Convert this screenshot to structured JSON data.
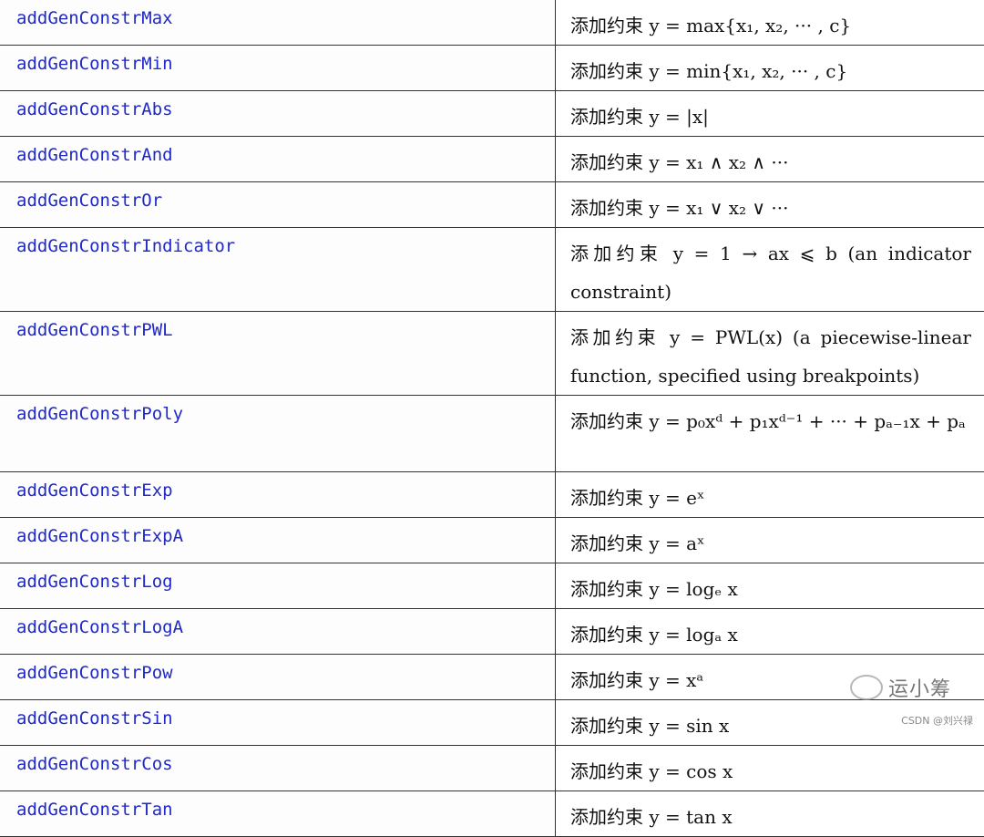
{
  "rows": [
    {
      "fn": "addGenConstrMax",
      "desc": "添加约束 y = max{x₁, x₂, ··· , c}"
    },
    {
      "fn": "addGenConstrMin",
      "desc": "添加约束 y = min{x₁, x₂, ··· , c}"
    },
    {
      "fn": "addGenConstrAbs",
      "desc": "添加约束 y = |x|"
    },
    {
      "fn": "addGenConstrAnd",
      "desc": "添加约束 y = x₁ ∧ x₂ ∧ ···"
    },
    {
      "fn": "addGenConstrOr",
      "desc": "添加约束 y = x₁ ∨ x₂ ∨ ···"
    },
    {
      "fn": "addGenConstrIndicator",
      "desc": "添加约束 y = 1 → ax ⩽ b (an indicator constraint)"
    },
    {
      "fn": "addGenConstrPWL",
      "desc": "添加约束 y = PWL(x) (a piecewise-linear function, specified using breakpoints)"
    },
    {
      "fn": "addGenConstrPoly",
      "desc": "添加约束 y = p₀xᵈ + p₁xᵈ⁻¹ + ··· + pₐ₋₁x + pₐ"
    },
    {
      "fn": "addGenConstrExp",
      "desc": "添加约束 y = eˣ"
    },
    {
      "fn": "addGenConstrExpA",
      "desc": "添加约束 y = aˣ"
    },
    {
      "fn": "addGenConstrLog",
      "desc": "添加约束 y = logₑ x"
    },
    {
      "fn": "addGenConstrLogA",
      "desc": "添加约束 y = logₐ x"
    },
    {
      "fn": "addGenConstrPow",
      "desc": "添加约束 y = xᵃ"
    },
    {
      "fn": "addGenConstrSin",
      "desc": "添加约束 y = sin x"
    },
    {
      "fn": "addGenConstrCos",
      "desc": "添加约束 y = cos x"
    },
    {
      "fn": "addGenConstrTan",
      "desc": "添加约束 y = tan x"
    }
  ],
  "watermark": {
    "text": "运小筹",
    "icon": "wechat-icon"
  },
  "credit": "CSDN @刘兴禄"
}
